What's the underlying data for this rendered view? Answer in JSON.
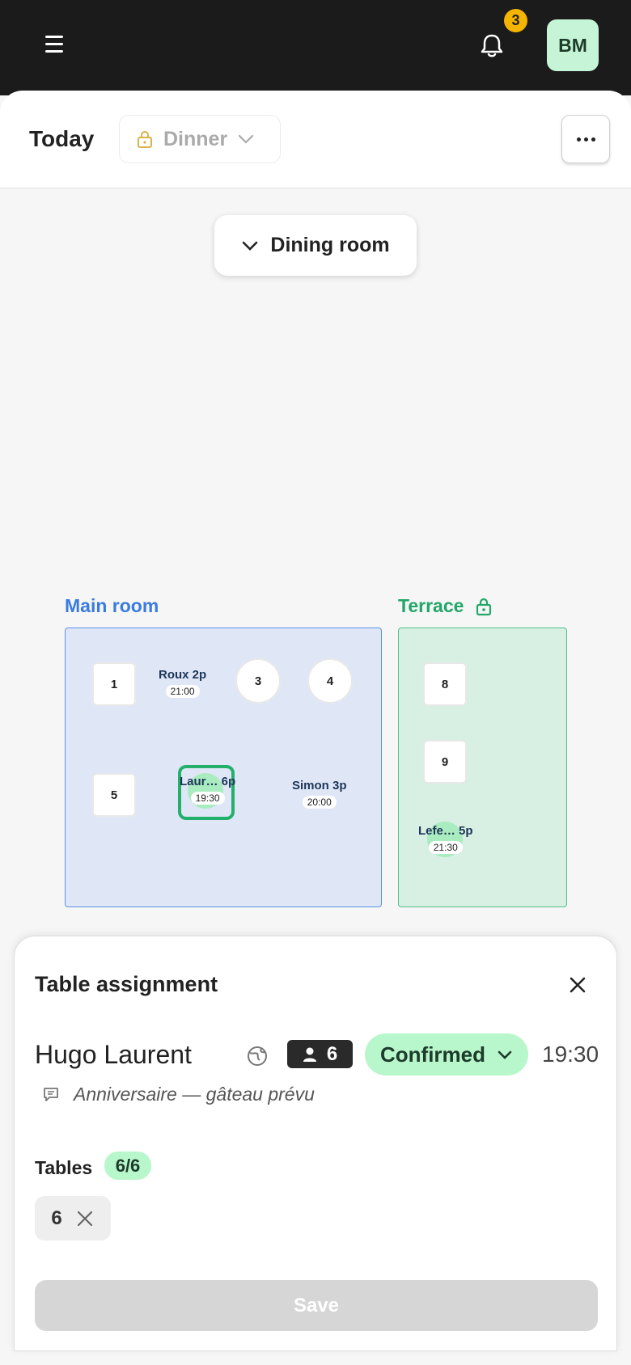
{
  "topbar": {
    "notification_count": "3",
    "avatar_initials": "BM",
    "icons": [
      "hamburger-menu-icon",
      "bell-icon"
    ]
  },
  "header": {
    "date_label": "Today",
    "service": "Dinner",
    "service_locked": true
  },
  "floorplan": {
    "room_selector": "Dining room",
    "areas": [
      {
        "name": "Main room",
        "color": "#3a7be0"
      },
      {
        "name": "Terrace",
        "color": "#22a669",
        "locked": true
      }
    ],
    "tables": {
      "t1": "1",
      "t3": "3",
      "t4": "4",
      "t5": "5",
      "t8": "8",
      "t9": "9"
    },
    "bookings": {
      "roux": {
        "label": "Roux 2p",
        "time": "21:00"
      },
      "laurent": {
        "label": "Laur… 6p",
        "time": "19:30",
        "selected": true
      },
      "simon": {
        "label": "Simon 3p",
        "time": "20:00"
      },
      "lefe": {
        "label": "Lefe… 5p",
        "time": "21:30"
      }
    }
  },
  "sheet": {
    "title": "Table assignment",
    "guest_name": "Hugo Laurent",
    "party_size": "6",
    "status": "Confirmed",
    "status_color": "#b8f7cb",
    "time": "19:30",
    "note": "Anniversaire — gâteau prévu",
    "tables_label": "Tables",
    "tables_count": "6/6",
    "assigned_table": "6",
    "save_label": "Save"
  }
}
